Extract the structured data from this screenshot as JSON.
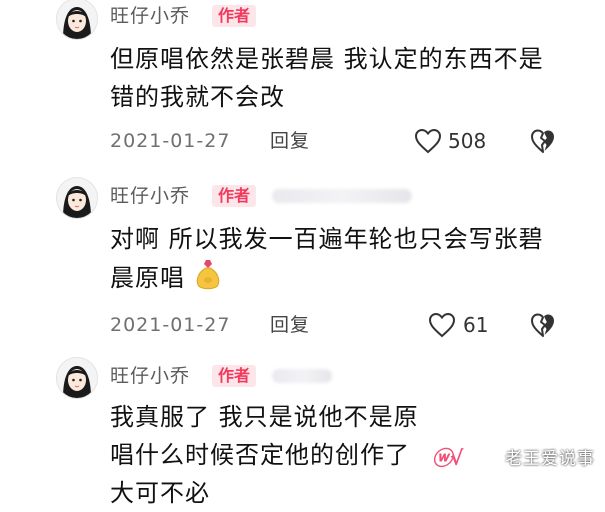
{
  "comments": [
    {
      "username": "旺仔小乔",
      "badge": "作者",
      "text": "但原唱依然是张碧晨 我认定的东西不是错的我就不会改",
      "date": "2021-01-27",
      "reply_label": "回复",
      "likes": "508"
    },
    {
      "username": "旺仔小乔",
      "badge": "作者",
      "text": "对啊 所以我发一百遍年轮也只会写张碧晨原唱",
      "date": "2021-01-27",
      "reply_label": "回复",
      "likes": "61"
    },
    {
      "username": "旺仔小乔",
      "badge": "作者",
      "text": "我真服了 我只是说他不是原唱什么时候否定他的创作了 大可不必"
    }
  ],
  "icons": {
    "like": "heart-outline-icon",
    "dislike": "broken-heart-icon",
    "emoji": "money-bag-emoji-icon"
  },
  "watermark": "老王爱说事",
  "colors": {
    "badge_bg": "#fde6ea",
    "badge_text": "#f23a5d"
  }
}
